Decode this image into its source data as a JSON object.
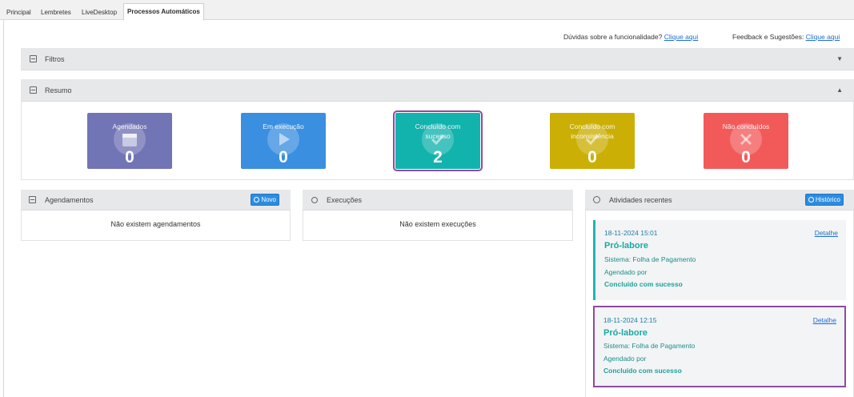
{
  "tabs": [
    {
      "label": "Principal"
    },
    {
      "label": "Lembretes"
    },
    {
      "label": "LiveDesktop"
    },
    {
      "label": "Processos Automáticos"
    }
  ],
  "help": {
    "doubts_text": "Dúvidas sobre a funcionalidade?",
    "doubts_link": "Clique aqui",
    "feedback_text": "Feedback e Sugestões:",
    "feedback_link": "Clique aqui"
  },
  "filters": {
    "title": "Filtros"
  },
  "summary": {
    "title": "Resumo",
    "cards": [
      {
        "title": "Agendados",
        "count": "0",
        "color": "#7174b5",
        "icon": "calendar-icon"
      },
      {
        "title": "Em execução",
        "count": "0",
        "color": "#3a8fe0",
        "icon": "play-icon"
      },
      {
        "title": "Concluído com sucesso",
        "count": "2",
        "color": "#12b3ad",
        "icon": "check-icon"
      },
      {
        "title": "Concluído com inconsistência",
        "count": "0",
        "color": "#cbaf04",
        "icon": "check-icon"
      },
      {
        "title": "Não concluídos",
        "count": "0",
        "color": "#f25a5a",
        "icon": "close-icon"
      }
    ]
  },
  "schedules": {
    "title": "Agendamentos",
    "new_button": "Novo",
    "empty": "Não existem agendamentos"
  },
  "executions": {
    "title": "Execuções",
    "empty": "Não existem execuções"
  },
  "recent": {
    "title": "Atividades recentes",
    "history_button": "Histórico",
    "items": [
      {
        "date": "18-11-2024 15:01",
        "detail": "Detalhe",
        "title": "Pró-labore",
        "system": "Sistema: Folha de Pagamento",
        "scheduled_by": "Agendado por",
        "status": "Concluído com sucesso"
      },
      {
        "date": "18-11-2024 12:15",
        "detail": "Detalhe",
        "title": "Pró-labore",
        "system": "Sistema: Folha de Pagamento",
        "scheduled_by": "Agendado por",
        "status": "Concluído com sucesso"
      }
    ]
  }
}
